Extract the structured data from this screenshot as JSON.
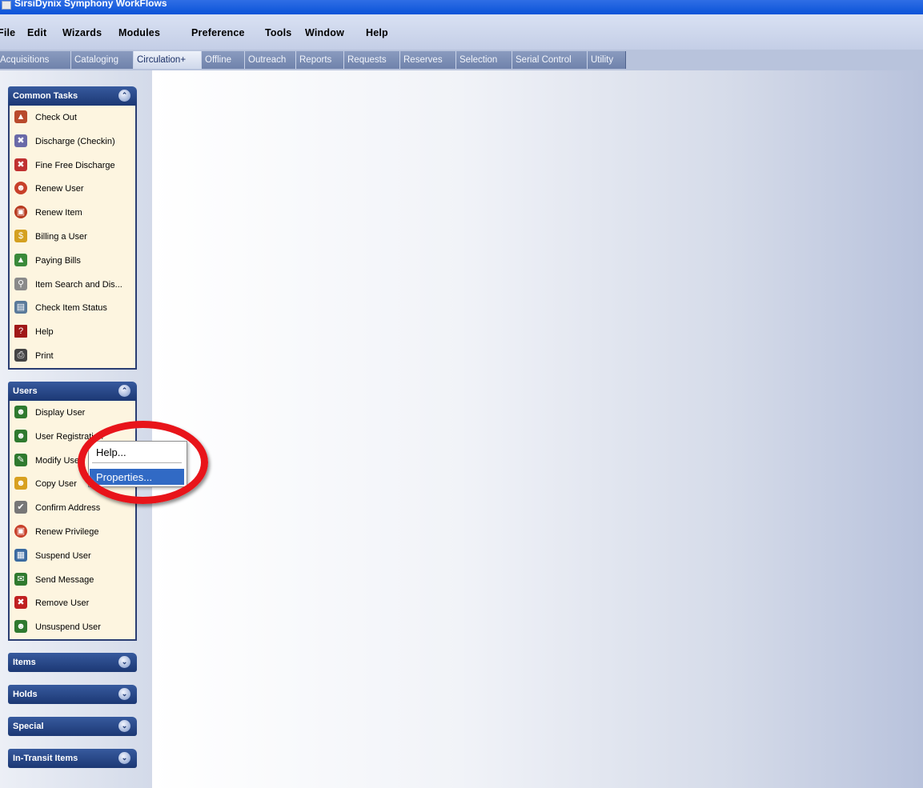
{
  "window": {
    "title": "SirsiDynix Symphony WorkFlows"
  },
  "menubar": [
    "File",
    "Edit",
    "Wizards",
    "Modules",
    "Preference",
    "Tools",
    "Window",
    "Help"
  ],
  "modules": [
    "Acquisitions",
    "Cataloging",
    "Circulation+",
    "Offline",
    "Outreach",
    "Reports",
    "Requests",
    "Reserves",
    "Selection",
    "Serial Control",
    "Utility"
  ],
  "active_module": "Circulation+",
  "groups": {
    "common": {
      "title": "Common Tasks",
      "toggle": "⌃",
      "items": [
        "Check Out",
        "Discharge (Checkin)",
        "Fine Free Discharge",
        "Renew User",
        "Renew Item",
        "Billing a User",
        "Paying Bills",
        "Item Search and Dis...",
        "Check Item Status",
        "Help",
        "Print"
      ]
    },
    "users": {
      "title": "Users",
      "toggle": "⌃",
      "items": [
        "Display User",
        "User Registration",
        "Modify User",
        "Copy User",
        "Confirm Address",
        "Renew Privilege",
        "Suspend User",
        "Send Message",
        "Remove User",
        "Unsuspend User"
      ]
    },
    "items": {
      "title": "Items",
      "toggle": "⌄"
    },
    "holds": {
      "title": "Holds",
      "toggle": "⌄"
    },
    "special": {
      "title": "Special",
      "toggle": "⌄"
    },
    "intransit": {
      "title": "In-Transit Items",
      "toggle": "⌄"
    }
  },
  "context_menu": {
    "help": "Help...",
    "properties": "Properties...",
    "selected": "Properties..."
  },
  "colors": {
    "highlight_ring": "#e8141a",
    "menu_selection": "#316ac5",
    "group_header": "#1c3874",
    "task_background": "#fdf5e0"
  }
}
